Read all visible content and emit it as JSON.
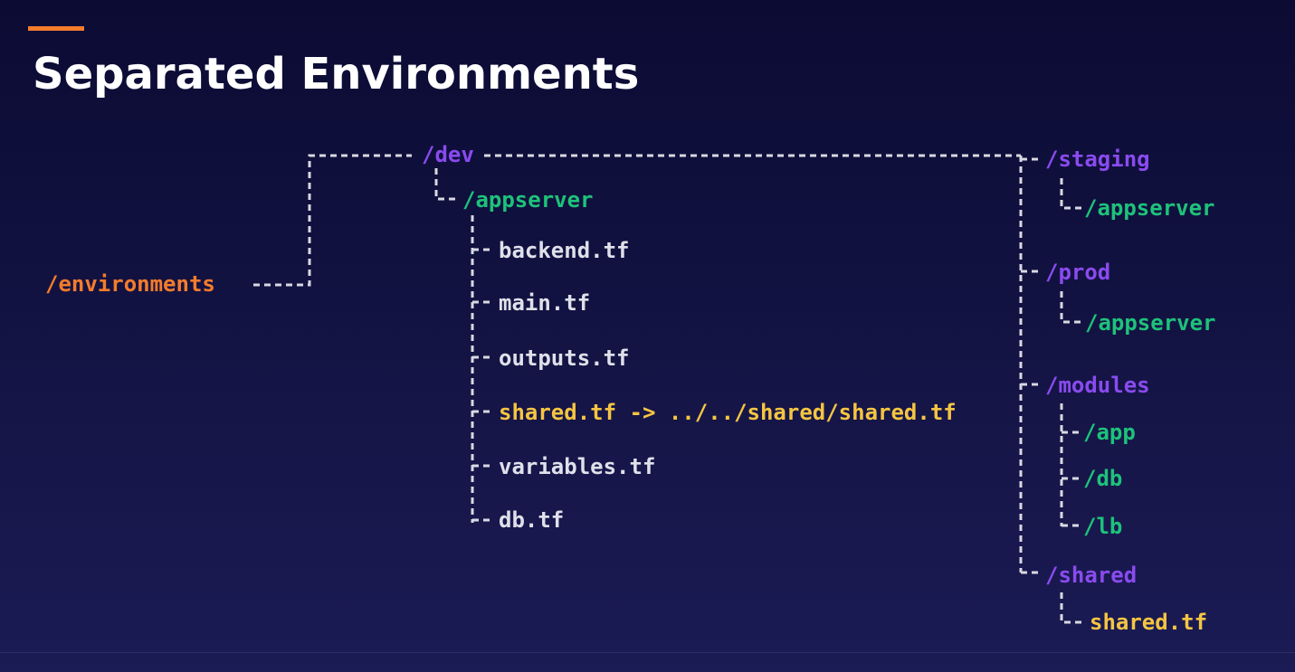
{
  "title": "Separated Environments",
  "colors": {
    "accent": "#f47c2c",
    "directory": "#8a4bef",
    "subdirectory": "#1ec27a",
    "file": "#dfe0ea",
    "shared": "#f5c542",
    "background": "#141445"
  },
  "tree": {
    "root": "/environments",
    "dev": {
      "name": "/dev",
      "appserver": {
        "name": "/appserver",
        "files": {
          "backend": "backend.tf",
          "main": "main.tf",
          "outputs": "outputs.tf",
          "shared_link": "shared.tf -> ../../shared/shared.tf",
          "variables": "variables.tf",
          "db": "db.tf"
        }
      }
    },
    "staging": {
      "name": "/staging",
      "appserver": "/appserver"
    },
    "prod": {
      "name": "/prod",
      "appserver": "/appserver"
    },
    "modules": {
      "name": "/modules",
      "app": "/app",
      "db": "/db",
      "lb": "/lb"
    },
    "shared": {
      "name": "/shared",
      "file": "shared.tf"
    }
  }
}
